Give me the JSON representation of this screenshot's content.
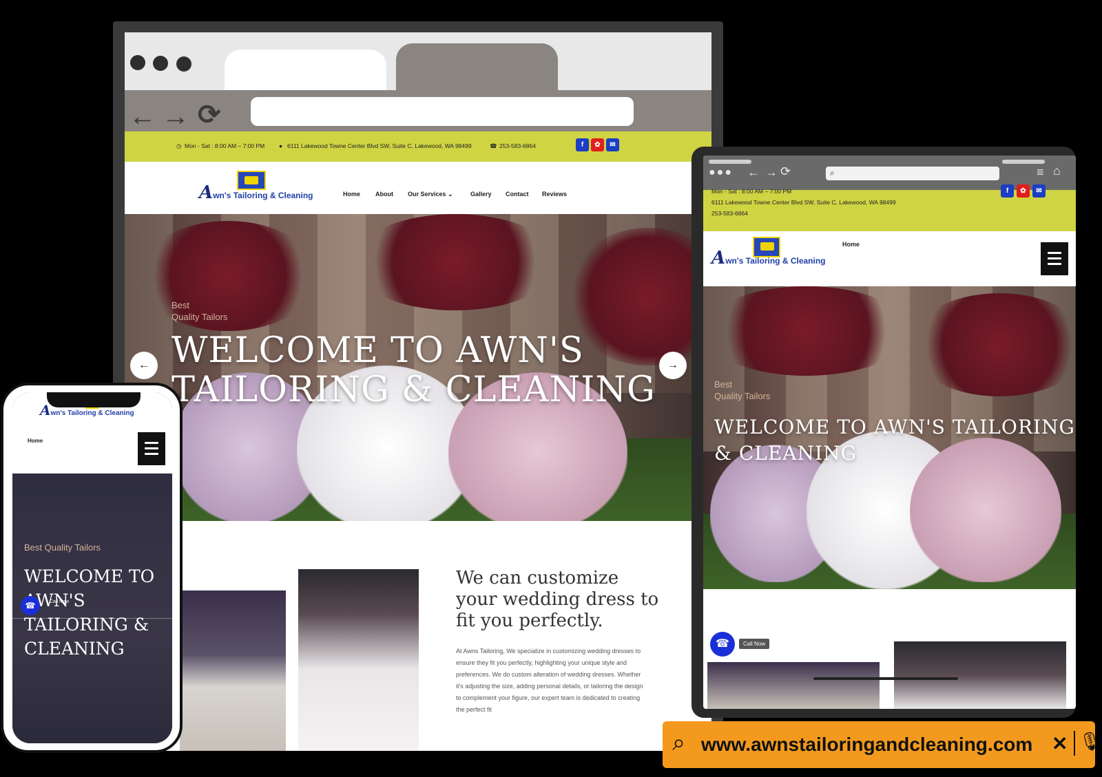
{
  "site": {
    "hours": "Mon - Sat : 8:00 AM – 7:00 PM",
    "address": "6111 Lakewood Towne Center Blvd SW, Suite C, Lakewood, WA 98499",
    "phone": "253-583-6864",
    "logo_letter": "A",
    "logo_text": "wn's Tailoring & Cleaning",
    "nav": [
      "Home",
      "About",
      "Our Services",
      "Gallery",
      "Contact",
      "Reviews"
    ],
    "nav_dropdown_icon": "chevron-down-icon",
    "social_icons": [
      "facebook-icon",
      "yelp-icon",
      "email-icon"
    ],
    "social_colors": [
      "#1b3ec2",
      "#e01f1f",
      "#1b3ec2"
    ],
    "accent_color": "#cfd443"
  },
  "hero": {
    "eyebrow": "Best Quality Tailors",
    "eyebrow_line1": "Best",
    "eyebrow_line2": "Quality Tailors",
    "title_line1": "WELCOME TO AWN'S",
    "title_line2": "TAILORING & CLEANING",
    "prev_icon": "arrow-left-icon",
    "next_icon": "arrow-right-icon"
  },
  "custom": {
    "title": "We can customize your wedding dress to fit you perfectly.",
    "body": "At Awns Tailoring, We specialize in customizing wedding dresses to ensure they fit you perfectly, highlighting your unique style and preferences. We do custom alteration of wedding dresses. Whether it's adjusting the size, adding personal details, or tailoring the design to complement your figure, our expert team is dedicated to creating the perfect fit"
  },
  "tablet": {
    "menu_label": "Home",
    "hero_title_line1": "WELCOME TO AWN'S TAILORING",
    "hero_title_line2": "& CLEANING",
    "call_label": "Call Now"
  },
  "phone": {
    "menu_label": "Home",
    "eyebrow": "Best Quality Tailors",
    "title_lines": [
      "WELCOME TO",
      "AWN'S",
      "TAILORING &",
      "CLEANING"
    ],
    "call_label": "Call Now"
  },
  "search": {
    "url": "www.awnstailoringandcleaning.com",
    "search_icon": "search-icon",
    "clear_icon": "close-icon",
    "mic_icon": "microphone-icon",
    "color": "#f39a1e"
  }
}
